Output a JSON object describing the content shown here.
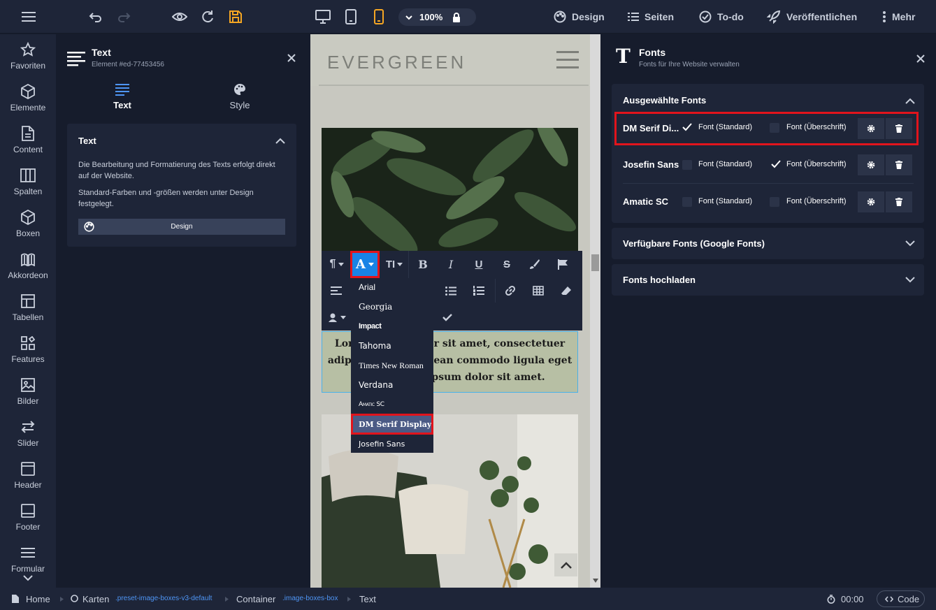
{
  "topbar": {
    "zoom": "100%",
    "nav": {
      "design": "Design",
      "pages": "Seiten",
      "todo": "To-do",
      "publish": "Veröffentlichen",
      "more": "Mehr"
    }
  },
  "sidebar": {
    "items": [
      {
        "label": "Favoriten",
        "icon": "star-icon"
      },
      {
        "label": "Elemente",
        "icon": "cube-icon"
      },
      {
        "label": "Content",
        "icon": "document-icon"
      },
      {
        "label": "Spalten",
        "icon": "columns-icon"
      },
      {
        "label": "Boxen",
        "icon": "box-icon"
      },
      {
        "label": "Akkordeon",
        "icon": "accordion-icon"
      },
      {
        "label": "Tabellen",
        "icon": "table-icon"
      },
      {
        "label": "Features",
        "icon": "features-icon"
      },
      {
        "label": "Bilder",
        "icon": "image-icon"
      },
      {
        "label": "Slider",
        "icon": "slider-icon"
      },
      {
        "label": "Header",
        "icon": "header-icon"
      },
      {
        "label": "Footer",
        "icon": "footer-icon"
      },
      {
        "label": "Formular",
        "icon": "form-icon"
      }
    ]
  },
  "element_panel": {
    "title": "Text",
    "subtitle": "Element #ed-77453456",
    "tabs": [
      {
        "label": "Text"
      },
      {
        "label": "Style"
      }
    ],
    "section_title": "Text",
    "desc1": "Die Bearbeitung und Formatierung des Texts erfolgt direkt auf der Website.",
    "desc2": "Standard-Farben und -größen werden unter Design festgelegt.",
    "design_button": "Design"
  },
  "canvas": {
    "logo": "EVERGREEN",
    "text_lines": [
      "Lorem ipsum dolor sit amet, consectetuer",
      "adipiscing elit. Aenean commodo ligula eget",
      "dolor. Lorem ipsum dolor sit amet."
    ]
  },
  "font_menu": {
    "items": [
      {
        "label": "Arial"
      },
      {
        "label": "Georgia"
      },
      {
        "label": "Impact"
      },
      {
        "label": "Tahoma"
      },
      {
        "label": "Times New Roman"
      },
      {
        "label": "Verdana"
      },
      {
        "label": "Amatic SC"
      },
      {
        "label": "DM Serif Display",
        "selected": true
      },
      {
        "label": "Josefin Sans"
      }
    ]
  },
  "fonts_panel": {
    "title": "Fonts",
    "subtitle": "Fonts für Ihre Website verwalten",
    "selected_section": "Ausgewählte Fonts",
    "fonts": [
      {
        "name": "DM Serif Di...",
        "std_label": "Font (Standard)",
        "head_label": "Font (Überschrift)",
        "std": true,
        "head": false
      },
      {
        "name": "Josefin Sans",
        "std_label": "Font (Standard)",
        "head_label": "Font (Überschrift)",
        "std": false,
        "head": true
      },
      {
        "name": "Amatic SC",
        "std_label": "Font (Standard)",
        "head_label": "Font (Überschrift)",
        "std": false,
        "head": false
      }
    ],
    "google_section": "Verfügbare Fonts (Google Fonts)",
    "upload_section": "Fonts hochladen"
  },
  "bottombar": {
    "crumbs": [
      {
        "label": "Home"
      },
      {
        "label": "Karten",
        "sub": ".preset-image-boxes-v3-default"
      },
      {
        "label": "Container",
        "sub": ".image-boxes-box"
      },
      {
        "label": "Text"
      }
    ],
    "time": "00:00",
    "code": "Code"
  },
  "colors": {
    "accent": "#4e95f5",
    "highlight": "#e1141c",
    "save": "#f5a623",
    "mobile": "#f5a623"
  }
}
